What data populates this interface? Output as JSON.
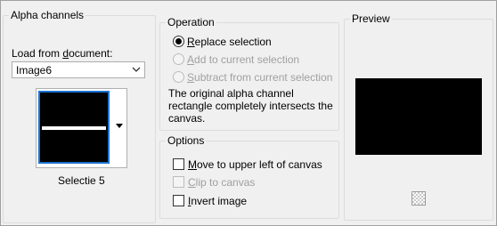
{
  "alpha_channels": {
    "title": "Alpha channels",
    "load_label_pre": "Load from ",
    "load_label_u": "d",
    "load_label_post": "ocument:",
    "document_value": "Image6",
    "thumbnail_caption": "Selectie 5"
  },
  "operation": {
    "title": "Operation",
    "options": [
      {
        "u": "R",
        "rest": "eplace selection",
        "checked": true,
        "enabled": true
      },
      {
        "u": "A",
        "rest": "dd to current selection",
        "checked": false,
        "enabled": false
      },
      {
        "u": "S",
        "rest": "ubtract from current selection",
        "checked": false,
        "enabled": false
      }
    ],
    "description_line1": "The original alpha channel",
    "description_line2": "rectangle completely intersects the",
    "description_line3": "canvas."
  },
  "options": {
    "title": "Options",
    "items": [
      {
        "u": "M",
        "rest": "ove to upper left of canvas",
        "checked": false,
        "enabled": true
      },
      {
        "u": "C",
        "rest": "lip to canvas",
        "checked": false,
        "enabled": false
      },
      {
        "u": "I",
        "rest": "nvert image",
        "checked": false,
        "enabled": true
      }
    ]
  },
  "preview": {
    "title": "Preview"
  }
}
